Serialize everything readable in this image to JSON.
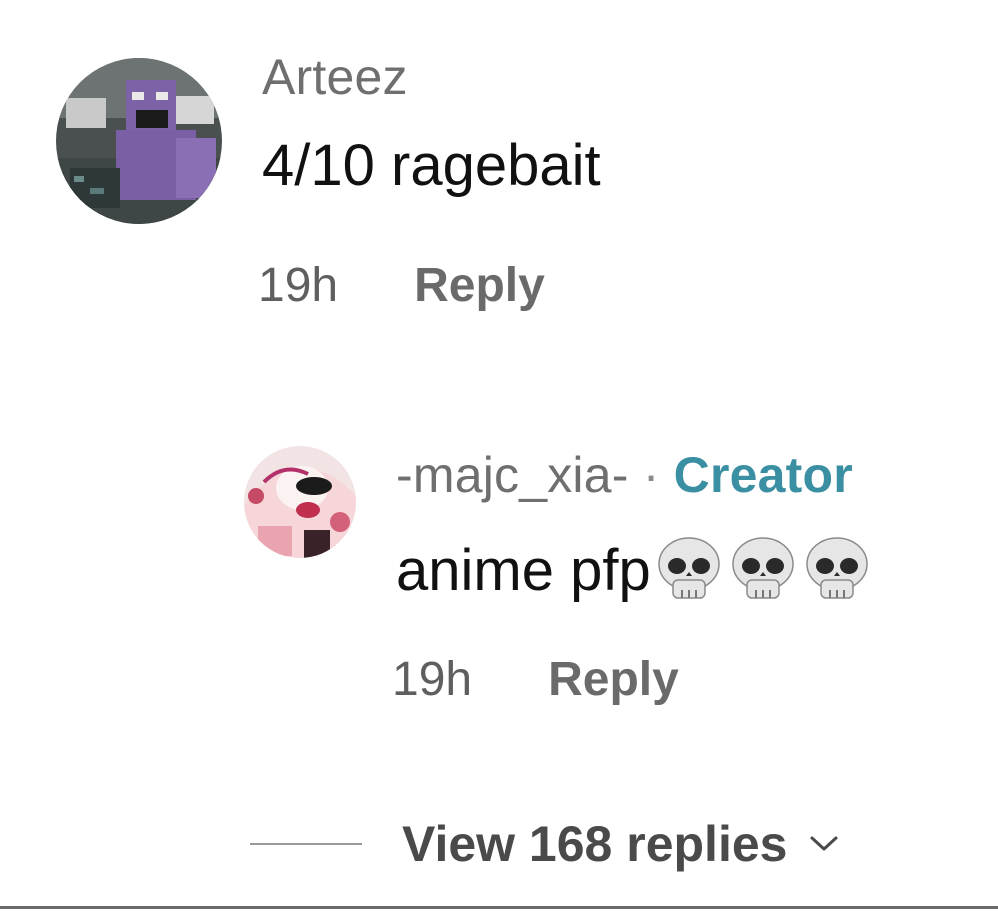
{
  "comments": [
    {
      "username": "Arteez",
      "text": "4/10 ragebait",
      "time": "19h",
      "reply_label": "Reply"
    }
  ],
  "replies": [
    {
      "username": "-majc_xia-",
      "separator": "·",
      "badge": "Creator",
      "text": "anime pfp",
      "emoji_icons": [
        "skull-emoji",
        "skull-emoji",
        "skull-emoji"
      ],
      "time": "19h",
      "reply_label": "Reply"
    }
  ],
  "view_replies_label": "View 168 replies",
  "icons": {
    "expand": "chevron-down-icon"
  },
  "colors": {
    "creator_badge": "#3a8fa3",
    "text_primary": "#111111",
    "text_secondary": "#6f6f6f"
  }
}
